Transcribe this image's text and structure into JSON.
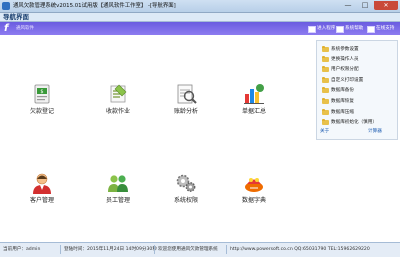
{
  "window": {
    "title": "通风欠款管理系统v2015.01试用版【通风软件工作室】 -[导航界面]",
    "min_icon": "minimize-icon",
    "max_icon": "maximize-icon",
    "close_icon": "close-icon"
  },
  "menubar": {
    "label": "导航界面"
  },
  "banner": {
    "brand": "通风软件",
    "tools": [
      {
        "label": "进入程序"
      },
      {
        "label": "系统帮助"
      },
      {
        "label": "在线支持"
      }
    ]
  },
  "tiles": [
    {
      "label": "欠款登记",
      "icon": "debt-register-icon"
    },
    {
      "label": "收款作业",
      "icon": "receipt-icon"
    },
    {
      "label": "账龄分析",
      "icon": "aging-analysis-icon"
    },
    {
      "label": "单据汇总",
      "icon": "document-summary-icon"
    },
    {
      "label": "客户管理",
      "icon": "customer-icon"
    },
    {
      "label": "员工管理",
      "icon": "employee-icon"
    },
    {
      "label": "系统权限",
      "icon": "permission-gears-icon"
    },
    {
      "label": "数据字典",
      "icon": "data-dictionary-icon"
    }
  ],
  "side_panel": {
    "links": [
      {
        "label": "系统参数设置"
      },
      {
        "label": "更换操作人员"
      },
      {
        "label": "用户权限分配"
      },
      {
        "label": "自定义打印设置"
      },
      {
        "label": "数据库备份"
      },
      {
        "label": "数据库恢复"
      },
      {
        "label": "数据库压缩"
      },
      {
        "label": "数据库初始化（慎用）"
      }
    ],
    "footer_left": "关于",
    "footer_right": "计算器"
  },
  "status": {
    "user": "当前用户：admin",
    "login_time": "登陆时间：2015年11月24日 14时09分30秒",
    "welcome": "欢迎您使用通风欠款管理系统",
    "contact": "http://www.powersoft.co.cn  QQ:65031790  TEL:15962629220"
  },
  "colors": {
    "banner": "#7a6ae8",
    "titlebar": "#c4d7ee",
    "close": "#c94a3a"
  }
}
